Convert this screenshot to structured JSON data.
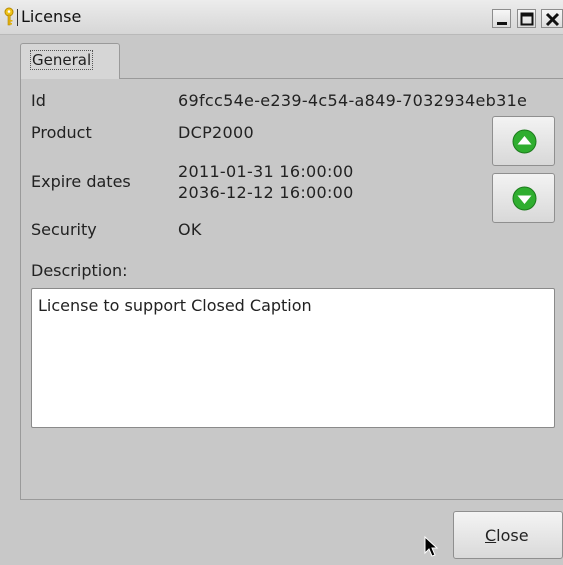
{
  "window": {
    "title": "License",
    "icon": "key-icon",
    "controls": [
      "minimize-icon",
      "maximize-icon",
      "close-icon"
    ]
  },
  "tabs": [
    {
      "label": "General",
      "selected": true
    }
  ],
  "fields": {
    "id": {
      "label": "Id",
      "value": "69fcc54e-e239-4c54-a849-7032934eb31e"
    },
    "product": {
      "label": "Product",
      "value": "DCP2000"
    },
    "expire": {
      "label": "Expire dates",
      "start": "2011-01-31 16:00:00",
      "end": "2036-12-12 16:00:00"
    },
    "security": {
      "label": "Security",
      "value": "OK"
    },
    "description": {
      "label": "Description:",
      "value": "License to support Closed Caption"
    }
  },
  "side_buttons": {
    "up_icon": "arrow-up-circle-icon",
    "down_icon": "arrow-down-circle-icon"
  },
  "footer": {
    "close_mnemonic": "C",
    "close_rest": "lose"
  },
  "colors": {
    "background": "#c8c8c8",
    "arrow_green": "#2fae2f",
    "description_bg": "#ffffff"
  }
}
